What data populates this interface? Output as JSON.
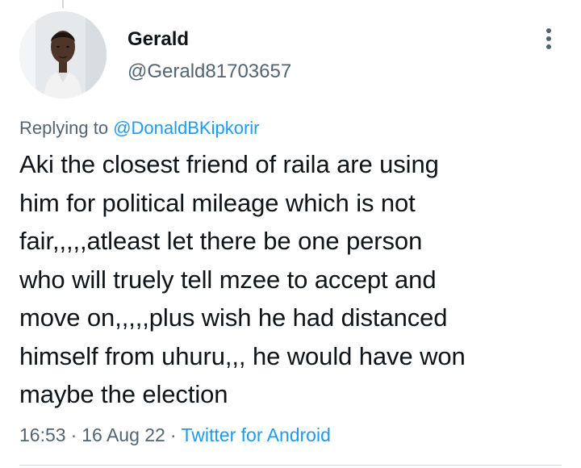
{
  "tweet": {
    "author": {
      "display_name": "Gerald",
      "handle": "@Gerald81703657",
      "avatar_icon": "user-avatar"
    },
    "replying_to": {
      "prefix": "Replying to",
      "mention": "@DonaldBKipkorir"
    },
    "text": "Aki the closest friend of raila are using\nhim for political mileage which is not\nfair,,,,,atleast let there be one person\nwho will truely tell mzee to accept and\nmove on,,,,,plus wish he had distanced\nhimself from uhuru,,, he would have won\nmaybe the election",
    "time": "16:53",
    "date": "16 Aug 22",
    "separator": "·",
    "source": "Twitter for Android",
    "more_icon": "more-vertical-icon"
  },
  "colors": {
    "text_primary": "#0f1419",
    "text_secondary": "#536471",
    "accent": "#1d9bf0",
    "divider": "#cfd9de"
  }
}
